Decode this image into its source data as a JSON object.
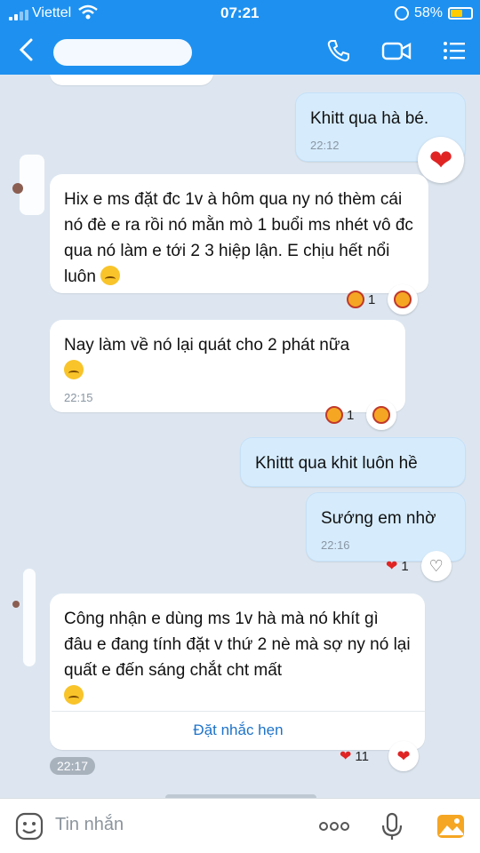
{
  "status": {
    "carrier": "Viettel",
    "time": "07:21",
    "battery": "58%",
    "battery_level": 0.58
  },
  "header": {
    "title_hidden": true
  },
  "messages": [
    {
      "id": "m1",
      "dir": "out",
      "text": "Khitt qua hà bé.",
      "time": "22:12",
      "reaction": "heart"
    },
    {
      "id": "m2",
      "dir": "in",
      "text": "Hix e ms đặt đc 1v à hôm qua ny nó thèm cái nó đè e ra rồi nó mằn mò 1 buổi ms nhét vô đc qua nó làm e tới 2 3 hiệp lận. E chịu hết nổi luôn",
      "reaction_count": "1"
    },
    {
      "id": "m3",
      "dir": "in",
      "text": "Nay làm về nó lại quát cho 2 phát nữa",
      "time": "22:15",
      "reaction_count": "1"
    },
    {
      "id": "m4",
      "dir": "out",
      "text": "Khittt qua khit luôn hề"
    },
    {
      "id": "m5",
      "dir": "out",
      "text": "Sướng em nhờ",
      "time": "22:16",
      "reaction_count": "1"
    },
    {
      "id": "m6",
      "dir": "in",
      "text": "Công nhận e dùng ms 1v hà mà nó khít gì đâu e đang tính đặt v thứ 2 nè mà sợ ny nó lại quất e đến sáng chắt cht mất",
      "reaction_count": "11"
    }
  ],
  "reminder_label": "Đặt nhắc hẹn",
  "time_pill": "22:17",
  "input": {
    "placeholder": "Tin nhắn"
  },
  "colors": {
    "header": "#1e91f0",
    "out_bubble": "#d6ecfd",
    "in_bubble": "#ffffff",
    "background": "#dde6f0",
    "link": "#1e73c9"
  }
}
